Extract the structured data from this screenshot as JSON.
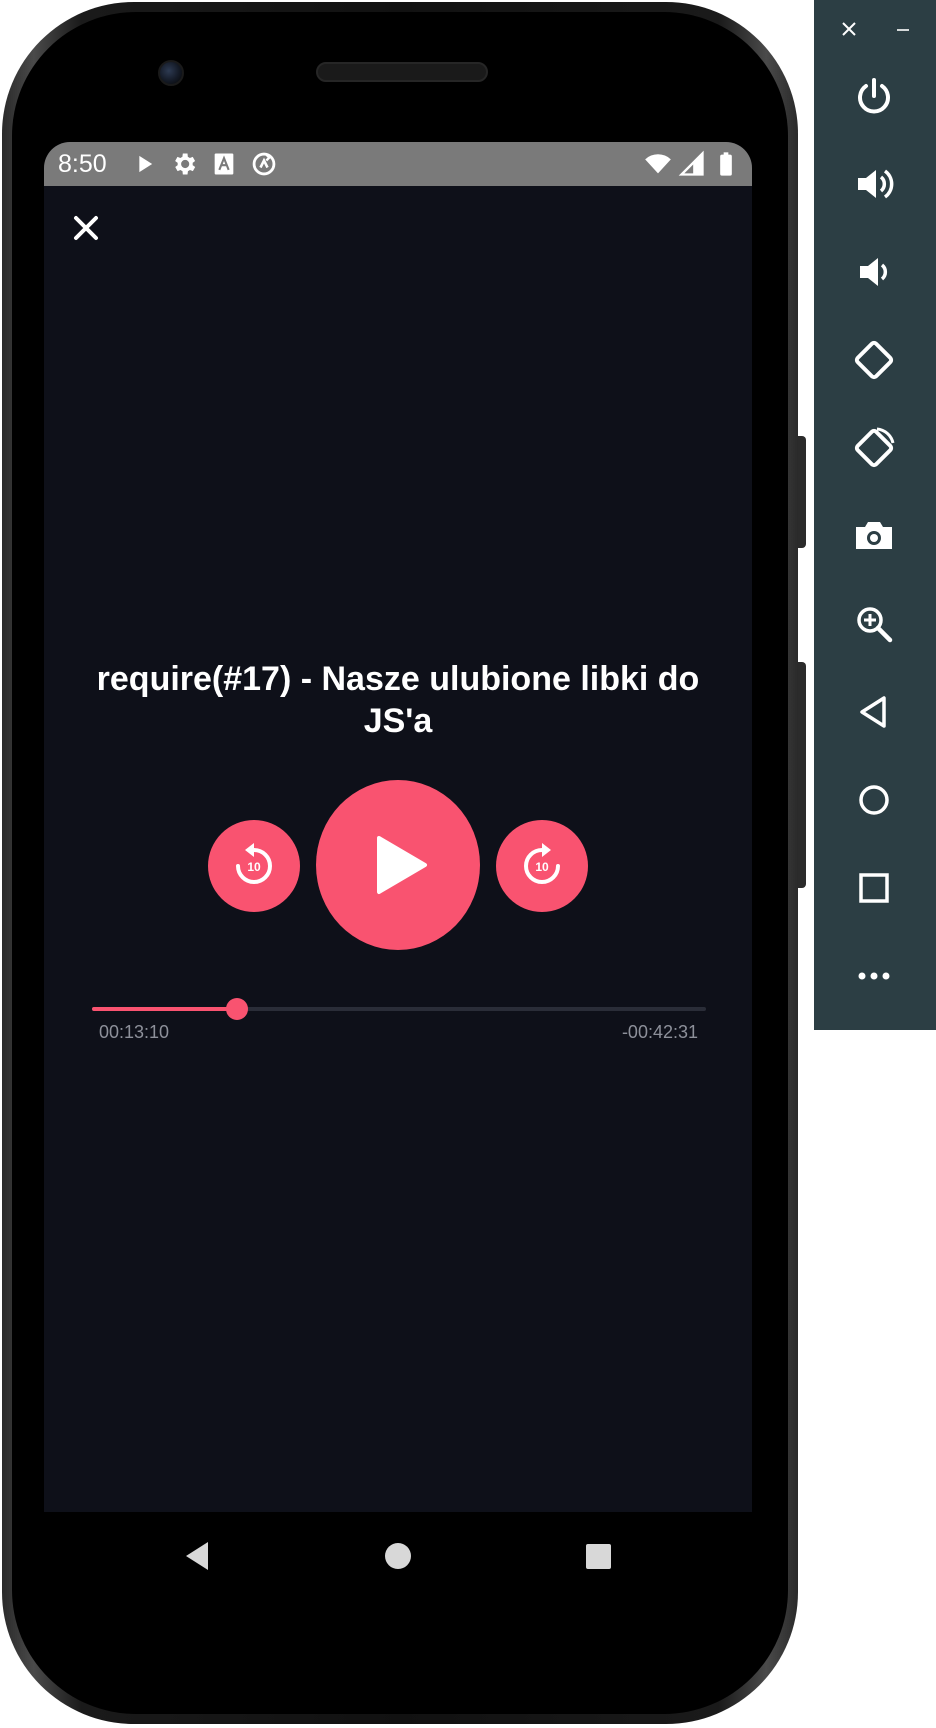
{
  "status_bar": {
    "time": "8:50",
    "icons_left": [
      "play-icon",
      "gear-icon",
      "font-icon",
      "sync-icon"
    ],
    "icons_right": [
      "wifi-icon",
      "signal-icon",
      "battery-icon"
    ]
  },
  "player": {
    "title": "require(#17) - Nasze ulubione libki do JS'a",
    "rewind_label": "10",
    "forward_label": "10",
    "elapsed": "00:13:10",
    "remaining": "-00:42:31",
    "progress_fraction": 0.236,
    "accent_color": "#f95370",
    "background_color": "#0e1019"
  },
  "emulator": {
    "tools": [
      "power-icon",
      "volume-up-icon",
      "volume-down-icon",
      "rotate-left-icon",
      "rotate-right-icon",
      "camera-icon",
      "zoom-icon",
      "back-icon",
      "home-icon",
      "overview-icon",
      "more-icon"
    ]
  }
}
